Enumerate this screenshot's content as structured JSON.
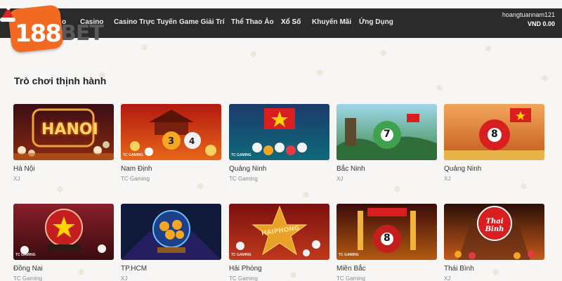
{
  "brand": {
    "logo_text_number": "188",
    "logo_text_word": "BET",
    "brand_color": "#f26a21"
  },
  "nav": {
    "partial_label": "o",
    "items": [
      {
        "label": "Casino",
        "icon": ""
      },
      {
        "label": "Casino Trực Tuyến",
        "icon": ""
      },
      {
        "label": "Game Giải Trí",
        "icon": ""
      },
      {
        "label": "Thể Thao Ảo",
        "icon": ""
      },
      {
        "label": "Xổ Số",
        "icon": "",
        "active": true
      },
      {
        "label": "Khuyến Mãi",
        "icon": ""
      },
      {
        "label": "Ứng Dụng",
        "icon": ""
      }
    ]
  },
  "account": {
    "username": "hoangtuannam121",
    "balance": "VND 0.00"
  },
  "section": {
    "title": "Trò chơi thịnh hành"
  },
  "games": [
    {
      "name": "Hà Nội",
      "provider": "XJ",
      "thumb_label": "HANOI",
      "tc_tag": ""
    },
    {
      "name": "Nam Định",
      "provider": "TC Gaming",
      "thumb_label": "",
      "tc_tag": "TC GAMING"
    },
    {
      "name": "Quảng Ninh",
      "provider": "TC Gaming",
      "thumb_label": "",
      "tc_tag": "TC GAMING"
    },
    {
      "name": "Bắc Ninh",
      "provider": "XJ",
      "thumb_label": "7",
      "tc_tag": ""
    },
    {
      "name": "Quảng Ninh",
      "provider": "XJ",
      "thumb_label": "8",
      "tc_tag": ""
    },
    {
      "name": "Đồng Nai",
      "provider": "TC Gaming",
      "thumb_label": "",
      "tc_tag": "TC GAMING"
    },
    {
      "name": "TP.HCM",
      "provider": "XJ",
      "thumb_label": "",
      "tc_tag": ""
    },
    {
      "name": "Hải Phòng",
      "provider": "TC Gaming",
      "thumb_label": "HAIPHONG",
      "tc_tag": "TC GAMING"
    },
    {
      "name": "Miền Bắc",
      "provider": "TC Gaming",
      "thumb_label": "8",
      "tc_tag": "TC GAMING"
    },
    {
      "name": "Thái Bình",
      "provider": "XJ",
      "thumb_label": "Thai Binh",
      "tc_tag": ""
    }
  ]
}
